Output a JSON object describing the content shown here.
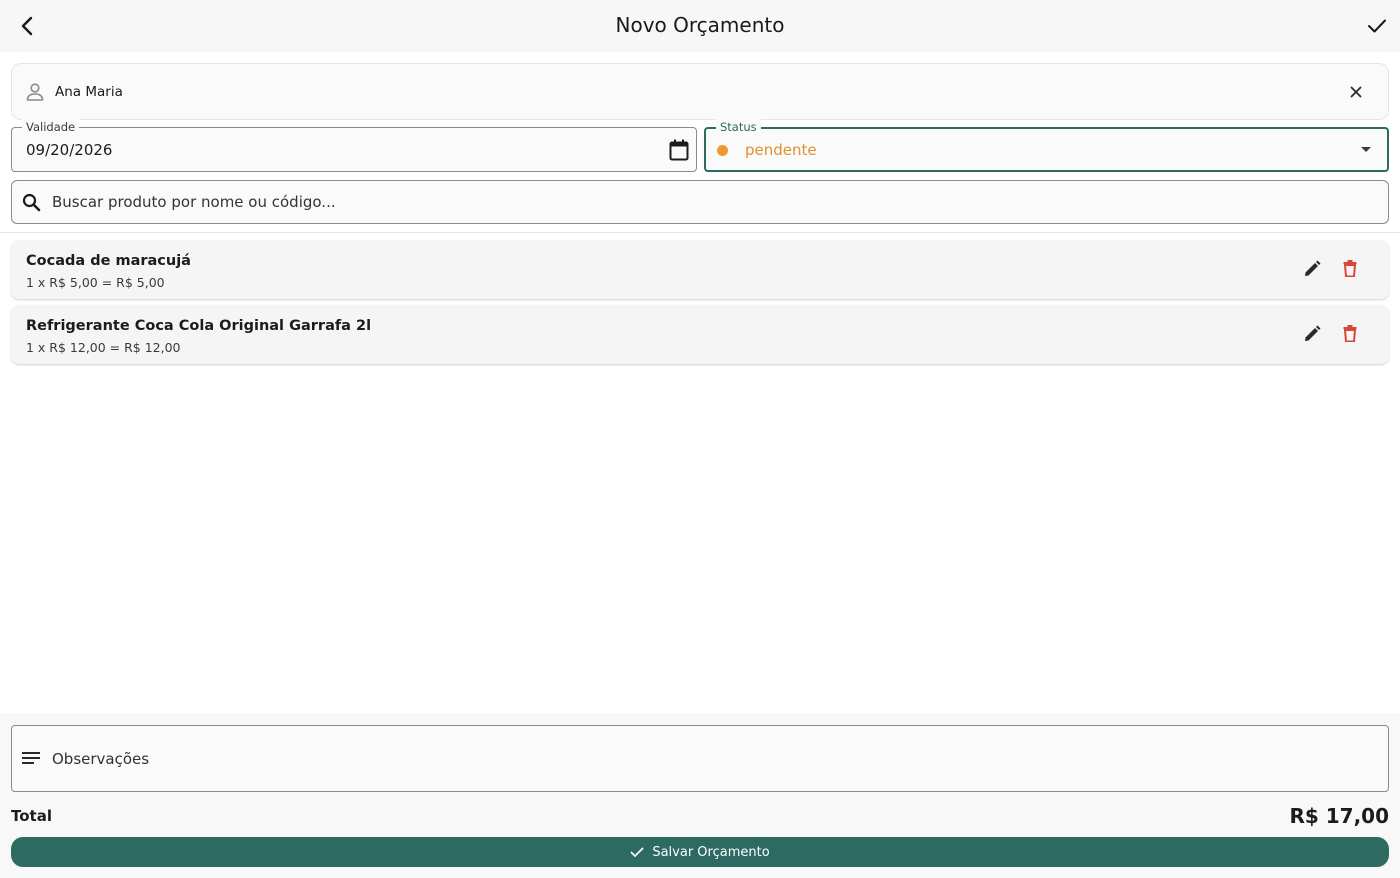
{
  "appbar": {
    "title": "Novo Orçamento",
    "back_icon": "arrow-back-icon",
    "confirm_icon": "check-icon"
  },
  "client": {
    "name": "Ana Maria",
    "icon": "person-icon",
    "clear_icon": "close-icon"
  },
  "validade": {
    "label": "Validade",
    "value": "09/20/2026",
    "icon": "calendar-icon"
  },
  "status": {
    "label": "Status",
    "value": "pendente",
    "color": "#ec9a2e"
  },
  "search": {
    "placeholder": "Buscar produto por nome ou código..."
  },
  "items": [
    {
      "name": "Cocada de maracujá",
      "detail": "1 x R$ 5,00 = R$ 5,00"
    },
    {
      "name": "Refrigerante Coca Cola Original Garrafa 2l",
      "detail": "1 x R$ 12,00 = R$ 12,00"
    }
  ],
  "observacoes": {
    "label": "Observações",
    "icon": "notes-icon"
  },
  "total": {
    "label": "Total",
    "value": "R$ 17,00"
  },
  "save_button": {
    "label": "Salvar Orçamento"
  },
  "colors": {
    "primary": "#2d6a61",
    "pending": "#ec9a2e",
    "delete": "#d9463a"
  }
}
